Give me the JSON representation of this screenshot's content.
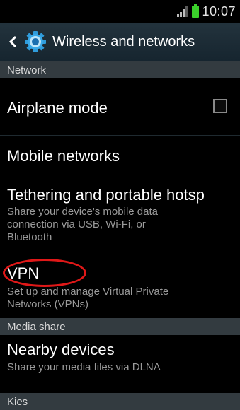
{
  "status_bar": {
    "time": "10:07",
    "icons": [
      "signal-icon",
      "battery-icon"
    ],
    "battery_color": "#3bd12b"
  },
  "header": {
    "title": "Wireless and networks",
    "back_icon": "chevron-left-icon",
    "settings_icon": "gear-icon",
    "bar_color": "#1e2e38"
  },
  "sections": {
    "network": "Network",
    "media_share": "Media share",
    "kies": "Kies"
  },
  "items": {
    "airplane": {
      "title": "Airplane mode",
      "checked": false
    },
    "mobile_networks": {
      "title": "Mobile networks"
    },
    "tethering": {
      "title": "Tethering and portable hotsp",
      "subtitle_line1": "Share your device's mobile data",
      "subtitle_line2": "connection via USB, Wi-Fi, or",
      "subtitle_line3": "Bluetooth"
    },
    "vpn": {
      "title": "VPN",
      "subtitle_line1": "Set up and manage Virtual Private",
      "subtitle_line2": "Networks (VPNs)"
    },
    "nearby_devices": {
      "title": "Nearby devices",
      "subtitle": "Share your media files via DLNA"
    }
  },
  "annotation_color": "#e01818"
}
